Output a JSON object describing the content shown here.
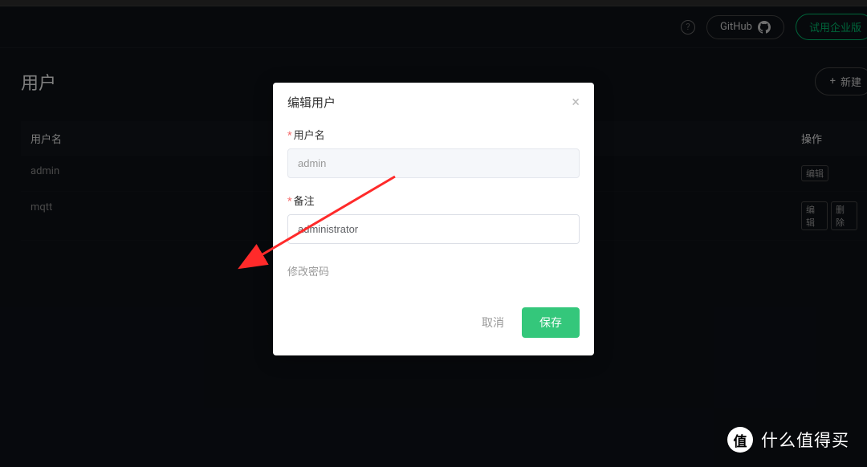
{
  "top_nav": {
    "github_label": "GitHub",
    "enterprise_label": "试用企业版"
  },
  "page": {
    "title": "用户",
    "add_button": "新建"
  },
  "table": {
    "header_username": "用户名",
    "header_actions": "操作",
    "rows": [
      {
        "username": "admin",
        "actions": [
          "编辑"
        ]
      },
      {
        "username": "mqtt",
        "actions": [
          "编辑",
          "删除"
        ]
      }
    ]
  },
  "modal": {
    "title": "编辑用户",
    "username_label": "用户名",
    "username_value": "admin",
    "remark_label": "备注",
    "remark_value": "administrator",
    "change_password": "修改密码",
    "cancel": "取消",
    "save": "保存"
  },
  "watermark": {
    "logo": "值",
    "text": "什么值得买"
  }
}
